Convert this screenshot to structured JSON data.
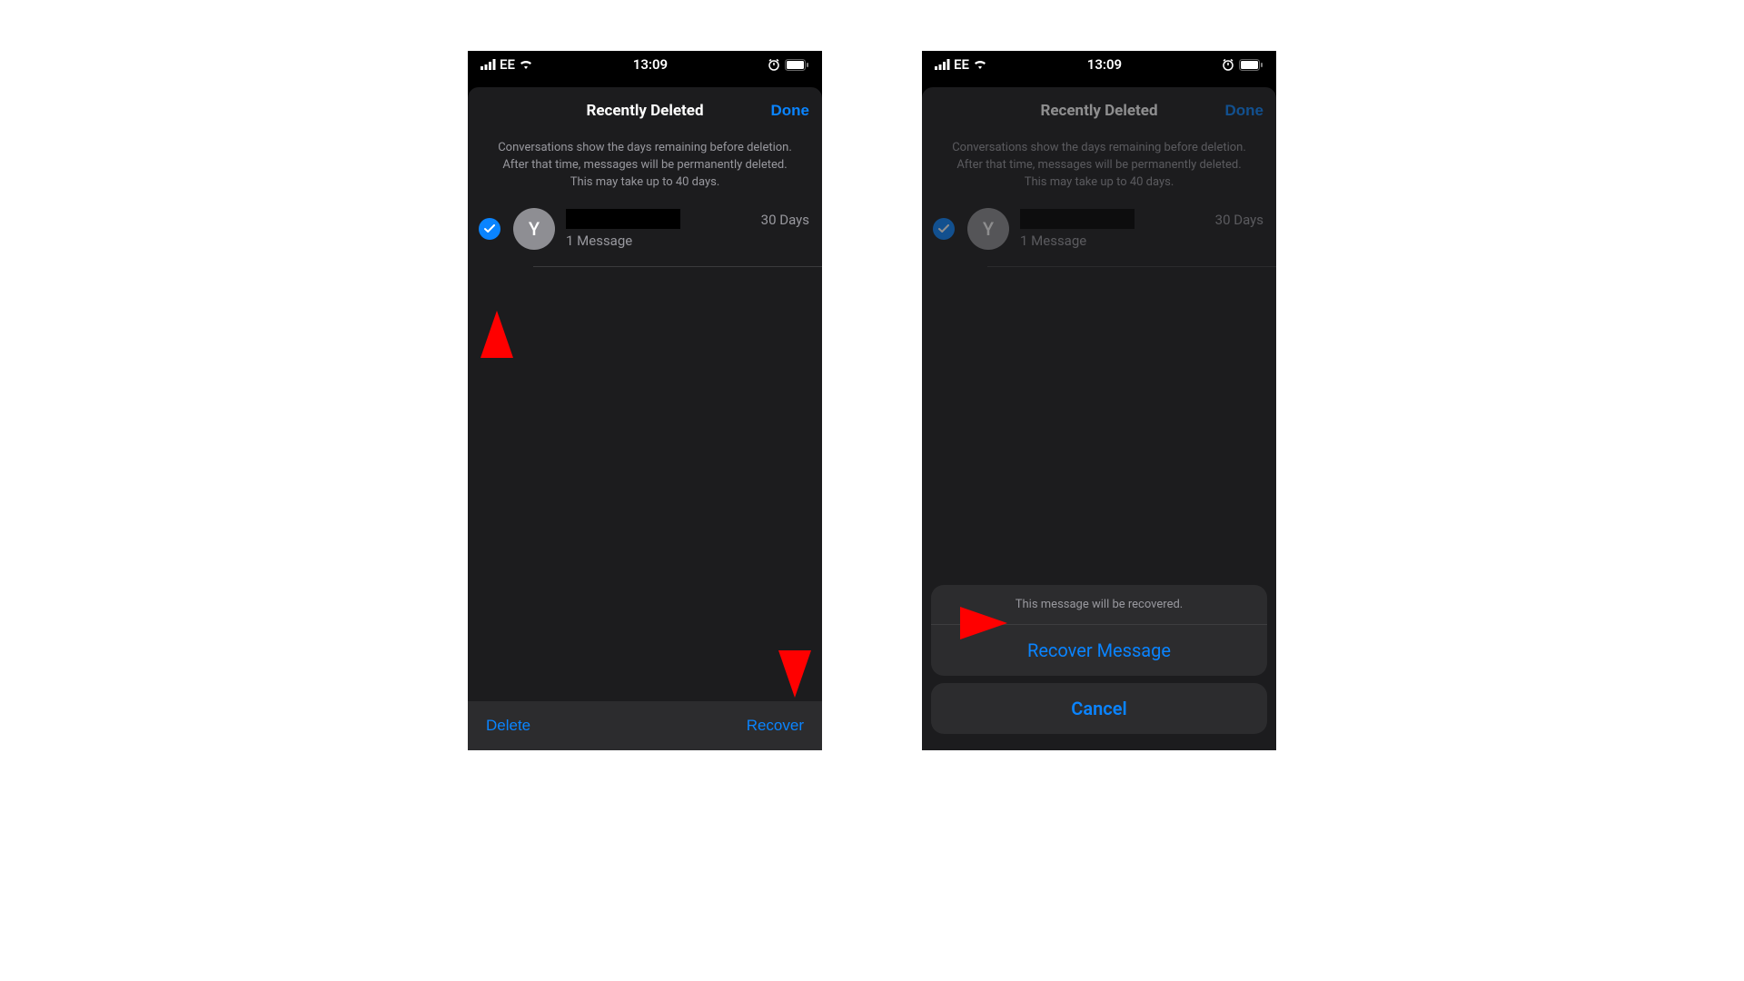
{
  "status": {
    "carrier": "EE",
    "time": "13:09"
  },
  "sheet": {
    "title": "Recently Deleted",
    "done": "Done",
    "subtitle": "Conversations show the days remaining before deletion. After that time, messages will be permanently deleted. This may take up to 40 days."
  },
  "conversation": {
    "avatar_initial": "Y",
    "message_count": "1 Message",
    "days_remaining": "30 Days"
  },
  "toolbar": {
    "delete_label": "Delete",
    "recover_label": "Recover"
  },
  "action_sheet": {
    "title": "This message will be recovered.",
    "action": "Recover Message",
    "cancel": "Cancel"
  },
  "colors": {
    "accent": "#0a84ff",
    "annotation": "#ff0000"
  }
}
